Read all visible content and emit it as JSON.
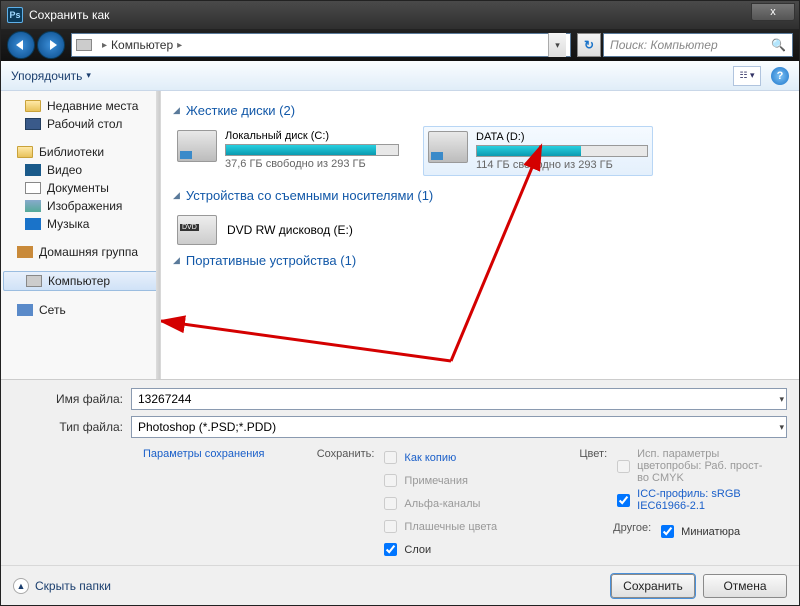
{
  "window": {
    "title": "Сохранить как",
    "close": "x"
  },
  "nav": {
    "path_root": "Компьютер",
    "search_placeholder": "Поиск: Компьютер"
  },
  "toolbar": {
    "organize": "Упорядочить"
  },
  "sidebar": {
    "recent": "Недавние места",
    "desktop": "Рабочий стол",
    "libraries": "Библиотеки",
    "videos": "Видео",
    "documents": "Документы",
    "pictures": "Изображения",
    "music": "Музыка",
    "homegroup": "Домашняя группа",
    "computer": "Компьютер",
    "network": "Сеть"
  },
  "content": {
    "hdd_header": "Жесткие диски (2)",
    "drive_c": {
      "name": "Локальный диск (C:)",
      "sub": "37,6 ГБ свободно из 293 ГБ",
      "fill_pct": 87
    },
    "drive_d": {
      "name": "DATA (D:)",
      "sub": "114 ГБ свободно из 293 ГБ",
      "fill_pct": 61
    },
    "removable_header": "Устройства со съемными носителями (1)",
    "dvd": "DVD RW дисковод (E:)",
    "portable_header": "Портативные устройства (1)"
  },
  "bottom": {
    "filename_label": "Имя файла:",
    "filename": "13267244",
    "filetype_label": "Тип файла:",
    "filetype": "Photoshop (*.PSD;*.PDD)",
    "save_params": "Параметры сохранения",
    "save_label": "Сохранить:",
    "as_copy": "Как копию",
    "notes": "Примечания",
    "alpha": "Альфа-каналы",
    "spot": "Плашечные цвета",
    "layers": "Слои",
    "color_label": "Цвет:",
    "proof": "Исп. параметры цветопробы: Раб. прост-во CMYK",
    "icc": "ICC-профиль: sRGB IEC61966-2.1",
    "other_label": "Другое:",
    "thumb": "Миниатюра"
  },
  "footer": {
    "hide": "Скрыть папки",
    "save": "Сохранить",
    "cancel": "Отмена"
  }
}
